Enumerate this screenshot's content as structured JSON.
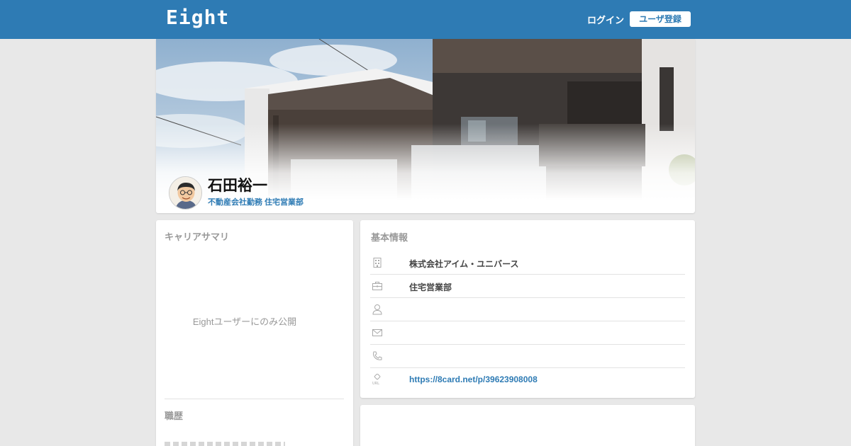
{
  "header": {
    "logo": "Eight",
    "login_label": "ログイン",
    "register_label": "ユーザ登録",
    "brand_color": "#2e7bb4"
  },
  "profile": {
    "name": "石田裕一",
    "affiliation": "不動産会社勤務 住宅営業部"
  },
  "career": {
    "title": "キャリアサマリ",
    "private_note": "Eightユーザーにのみ公開",
    "history_title": "職歴"
  },
  "basic_info": {
    "title": "基本情報",
    "rows": [
      {
        "icon": "building-icon",
        "value": "株式会社アイム・ユニバース"
      },
      {
        "icon": "briefcase-icon",
        "value": "住宅営業部"
      },
      {
        "icon": "person-icon",
        "value": ""
      },
      {
        "icon": "mail-icon",
        "value": ""
      },
      {
        "icon": "phone-icon",
        "value": ""
      },
      {
        "icon": "url-icon",
        "value": "https://8card.net/p/39623908008"
      }
    ]
  }
}
